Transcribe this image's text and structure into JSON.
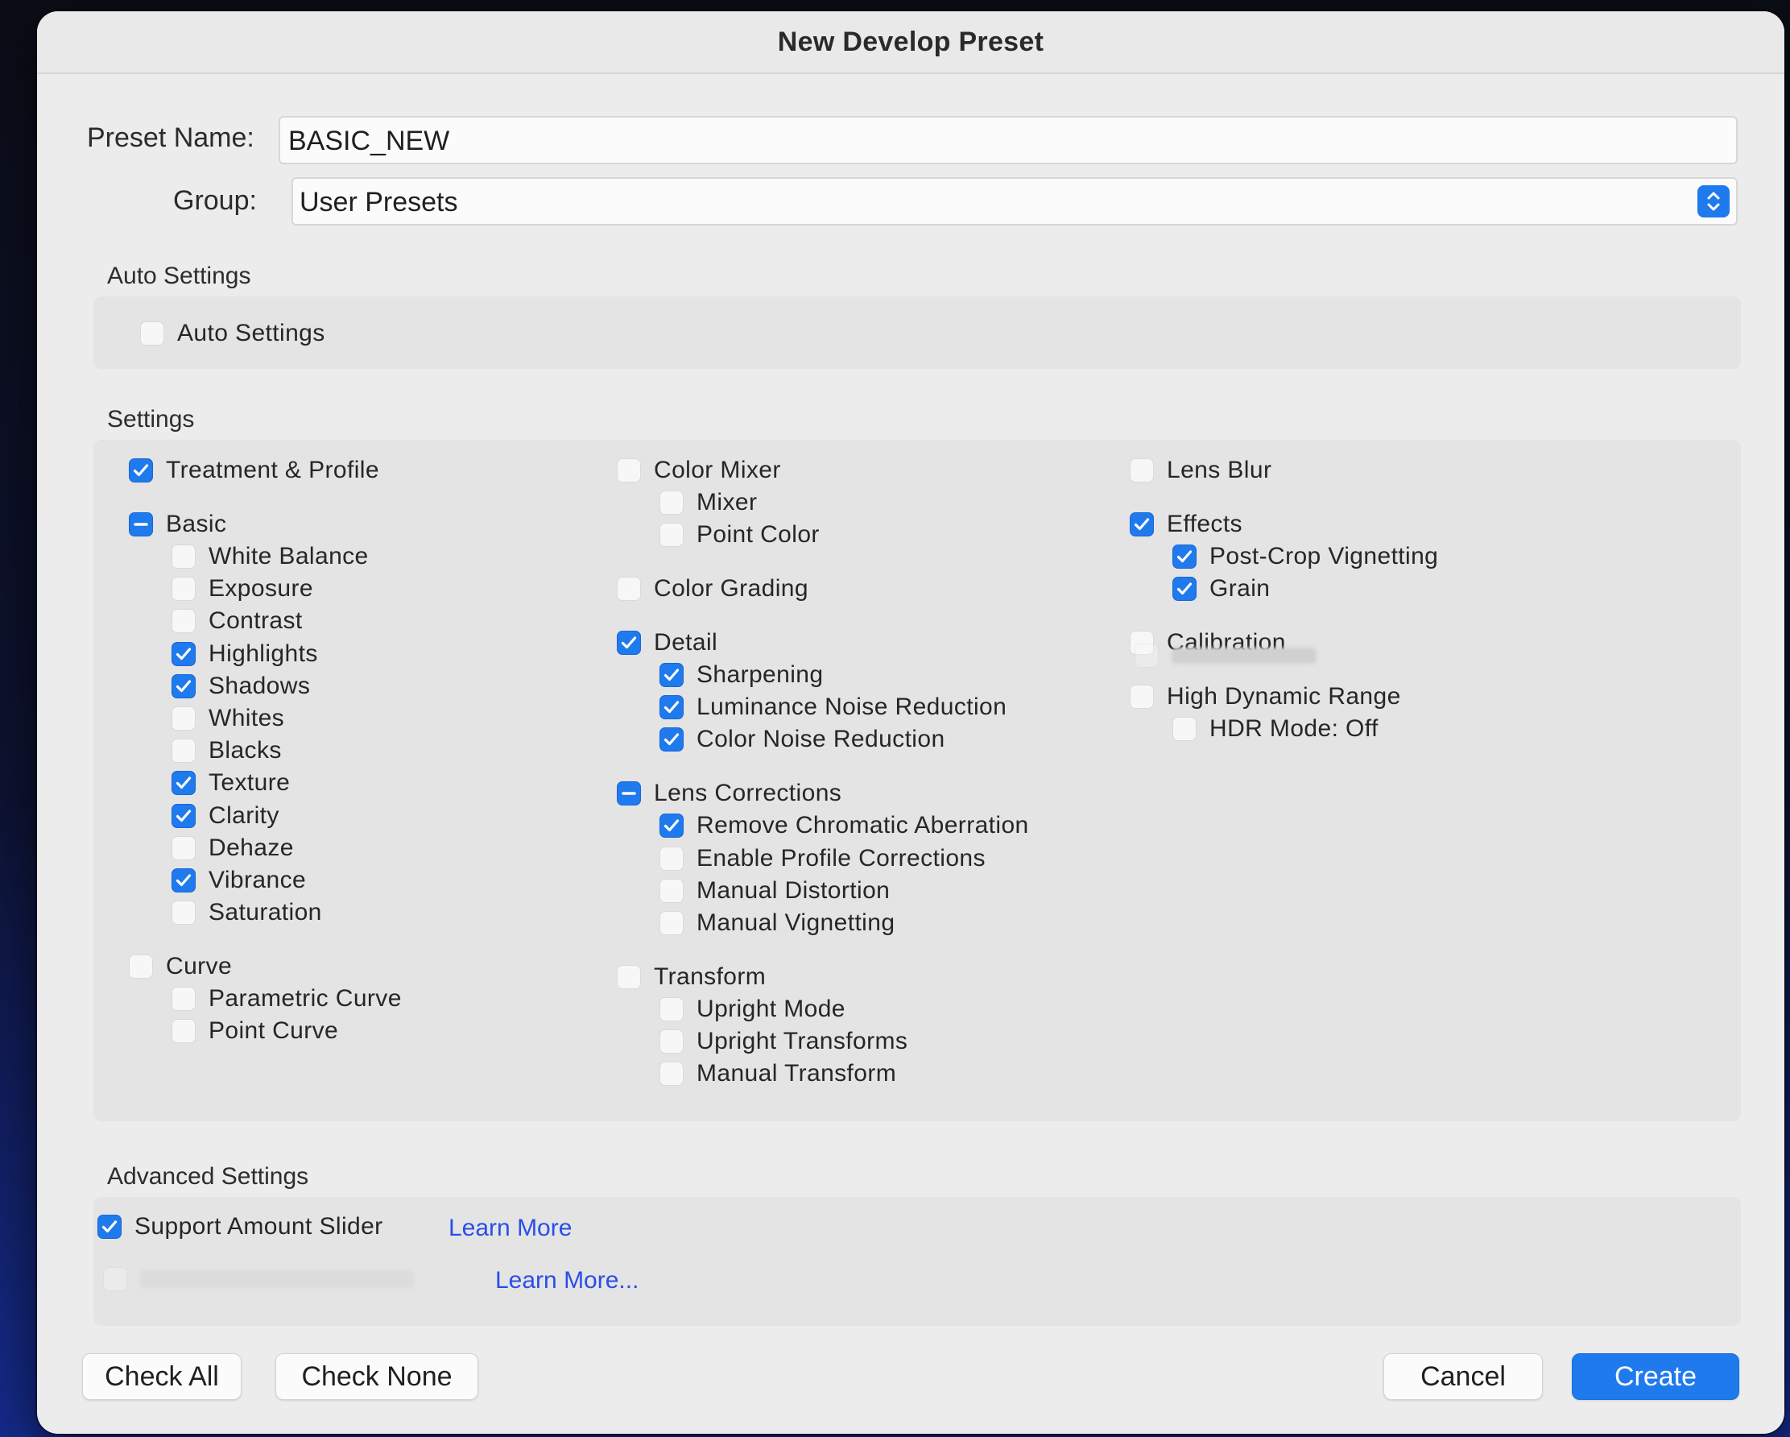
{
  "dialog": {
    "title": "New Develop Preset"
  },
  "form": {
    "preset_name_label": "Preset Name:",
    "preset_name_value": "BASIC_NEW",
    "group_label": "Group:",
    "group_value": "User Presets"
  },
  "auto_settings": {
    "heading": "Auto Settings",
    "item": {
      "label": "Auto Settings",
      "state": "off"
    }
  },
  "settings": {
    "heading": "Settings",
    "col1": [
      {
        "label": "Treatment & Profile",
        "state": "on",
        "level": 0
      },
      {
        "label": "Basic",
        "state": "mixed",
        "level": 0
      },
      {
        "label": "White Balance",
        "state": "off",
        "level": 1
      },
      {
        "label": "Exposure",
        "state": "off",
        "level": 1
      },
      {
        "label": "Contrast",
        "state": "off",
        "level": 1
      },
      {
        "label": "Highlights",
        "state": "on",
        "level": 1
      },
      {
        "label": "Shadows",
        "state": "on",
        "level": 1
      },
      {
        "label": "Whites",
        "state": "off",
        "level": 1
      },
      {
        "label": "Blacks",
        "state": "off",
        "level": 1
      },
      {
        "label": "Texture",
        "state": "on",
        "level": 1
      },
      {
        "label": "Clarity",
        "state": "on",
        "level": 1
      },
      {
        "label": "Dehaze",
        "state": "off",
        "level": 1
      },
      {
        "label": "Vibrance",
        "state": "on",
        "level": 1
      },
      {
        "label": "Saturation",
        "state": "off",
        "level": 1
      },
      {
        "label": "Curve",
        "state": "off",
        "level": 0
      },
      {
        "label": "Parametric Curve",
        "state": "off",
        "level": 1
      },
      {
        "label": "Point Curve",
        "state": "off",
        "level": 1
      }
    ],
    "col2": [
      {
        "label": "Color Mixer",
        "state": "off",
        "level": 0
      },
      {
        "label": "Mixer",
        "state": "off",
        "level": 1
      },
      {
        "label": "Point Color",
        "state": "off",
        "level": 1
      },
      {
        "label": "Color Grading",
        "state": "off",
        "level": 0
      },
      {
        "label": "Detail",
        "state": "on",
        "level": 0
      },
      {
        "label": "Sharpening",
        "state": "on",
        "level": 1
      },
      {
        "label": "Luminance Noise Reduction",
        "state": "on",
        "level": 1
      },
      {
        "label": "Color Noise Reduction",
        "state": "on",
        "level": 1
      },
      {
        "label": "Lens Corrections",
        "state": "mixed",
        "level": 0
      },
      {
        "label": "Remove Chromatic Aberration",
        "state": "on",
        "level": 1
      },
      {
        "label": "Enable Profile Corrections",
        "state": "off",
        "level": 1
      },
      {
        "label": "Manual Distortion",
        "state": "off",
        "level": 1
      },
      {
        "label": "Manual Vignetting",
        "state": "off",
        "level": 1
      },
      {
        "label": "Transform",
        "state": "off",
        "level": 0
      },
      {
        "label": "Upright Mode",
        "state": "off",
        "level": 1
      },
      {
        "label": "Upright Transforms",
        "state": "off",
        "level": 1
      },
      {
        "label": "Manual Transform",
        "state": "off",
        "level": 1
      }
    ],
    "col3": [
      {
        "label": "Lens Blur",
        "state": "off",
        "level": 0
      },
      {
        "label": "Effects",
        "state": "on",
        "level": 0
      },
      {
        "label": "Post-Crop Vignetting",
        "state": "on",
        "level": 1
      },
      {
        "label": "Grain",
        "state": "on",
        "level": 1
      },
      {
        "label": "Calibration",
        "state": "off",
        "level": 0
      },
      {
        "label": "High Dynamic Range",
        "state": "off",
        "level": 0
      },
      {
        "label": "HDR Mode: Off",
        "state": "off",
        "level": 1
      }
    ]
  },
  "advanced": {
    "heading": "Advanced Settings",
    "support_amount_slider": {
      "label": "Support Amount Slider",
      "state": "on"
    },
    "learn_more_1": "Learn More",
    "learn_more_2": "Learn More..."
  },
  "buttons": {
    "check_all": "Check All",
    "check_none": "Check None",
    "cancel": "Cancel",
    "create": "Create"
  },
  "colors": {
    "accent": "#1f7aee",
    "link": "#2a4ee8",
    "dialog_bg": "#ececec"
  }
}
